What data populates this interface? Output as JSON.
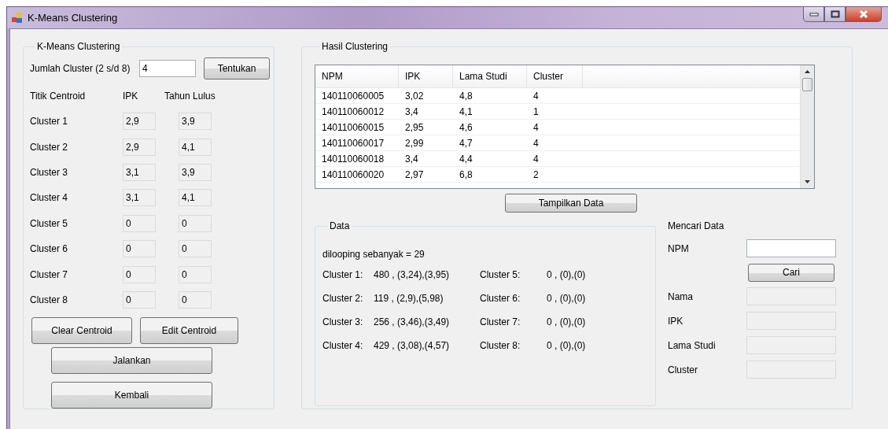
{
  "window": {
    "title": "K-Means Clustering"
  },
  "kmeans": {
    "legend": "K-Means Clustering",
    "count_label": "Jumlah Cluster (2 s/d 8)",
    "count_value": "4",
    "set_button": "Tentukan",
    "headers": [
      "Titik Centroid",
      "IPK",
      "Tahun Lulus"
    ],
    "centroids": [
      {
        "name": "Cluster 1",
        "ipk": "2,9",
        "tahun": "3,9"
      },
      {
        "name": "Cluster 2",
        "ipk": "2,9",
        "tahun": "4,1"
      },
      {
        "name": "Cluster 3",
        "ipk": "3,1",
        "tahun": "3,9"
      },
      {
        "name": "Cluster 4",
        "ipk": "3,1",
        "tahun": "4,1"
      },
      {
        "name": "Cluster 5",
        "ipk": "0",
        "tahun": "0"
      },
      {
        "name": "Cluster 6",
        "ipk": "0",
        "tahun": "0"
      },
      {
        "name": "Cluster 7",
        "ipk": "0",
        "tahun": "0"
      },
      {
        "name": "Cluster 8",
        "ipk": "0",
        "tahun": "0"
      }
    ],
    "buttons": [
      "Clear Centroid",
      "Edit Centroid",
      "Jalankan",
      "Kembali"
    ]
  },
  "hasil": {
    "legend": "Hasil Clustering",
    "table": {
      "columns": [
        "NPM",
        "IPK",
        "Lama Studi",
        "Cluster"
      ],
      "rows": [
        [
          "140110060005",
          "3,02",
          "4,8",
          "4"
        ],
        [
          "140110060012",
          "3,4",
          "4,1",
          "1"
        ],
        [
          "140110060015",
          "2,95",
          "4,6",
          "4"
        ],
        [
          "140110060017",
          "2,99",
          "4,7",
          "4"
        ],
        [
          "140110060018",
          "3,4",
          "4,4",
          "4"
        ],
        [
          "140110060020",
          "2,97",
          "6,8",
          "2"
        ]
      ]
    },
    "show_button": "Tampilkan Data"
  },
  "data": {
    "legend": "Data",
    "loop_text": "dilooping sebanyak = 29",
    "clusters": [
      {
        "label": "Cluster 1:",
        "value": "480 , (3,24),(3,95)"
      },
      {
        "label": "Cluster 5:",
        "value": "0 , (0),(0)"
      },
      {
        "label": "Cluster 2:",
        "value": "119 , (2,9),(5,98)"
      },
      {
        "label": "Cluster 6:",
        "value": "0 , (0),(0)"
      },
      {
        "label": "Cluster 3:",
        "value": "256 , (3,46),(3,49)"
      },
      {
        "label": "Cluster 7:",
        "value": "0 , (0),(0)"
      },
      {
        "label": "Cluster 4:",
        "value": "429 , (3,08),(4,57)"
      },
      {
        "label": "Cluster 8:",
        "value": "0 , (0),(0)"
      }
    ]
  },
  "search": {
    "title": "Mencari Data",
    "npm_label": "NPM",
    "button": "Cari",
    "fields": [
      {
        "label": "Nama",
        "disabled": true
      },
      {
        "label": "IPK",
        "disabled": true
      },
      {
        "label": "Lama Studi",
        "disabled": true
      },
      {
        "label": "Cluster",
        "disabled": true
      }
    ]
  }
}
